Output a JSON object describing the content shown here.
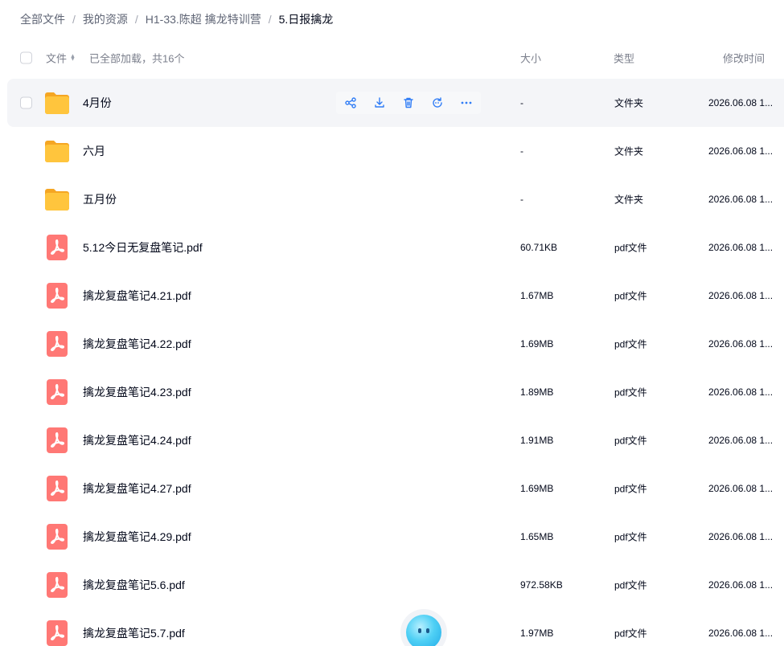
{
  "breadcrumb": {
    "items": [
      "全部文件",
      "我的资源",
      "H1-33.陈超 擒龙特训营"
    ],
    "current": "5.日报擒龙",
    "separator": "/"
  },
  "table": {
    "header": {
      "name": "文件",
      "count": "已全部加载，共16个",
      "size": "大小",
      "type": "类型",
      "time": "修改时间"
    },
    "rows": [
      {
        "name": "4月份",
        "size": "-",
        "type": "文件夹",
        "time": "2026.06.08 1...",
        "kind": "folder"
      },
      {
        "name": "六月",
        "size": "-",
        "type": "文件夹",
        "time": "2026.06.08 1...",
        "kind": "folder"
      },
      {
        "name": "五月份",
        "size": "-",
        "type": "文件夹",
        "time": "2026.06.08 1...",
        "kind": "folder"
      },
      {
        "name": "5.12今日无复盘笔记.pdf",
        "size": "60.71KB",
        "type": "pdf文件",
        "time": "2026.06.08 1...",
        "kind": "pdf"
      },
      {
        "name": "擒龙复盘笔记4.21.pdf",
        "size": "1.67MB",
        "type": "pdf文件",
        "time": "2026.06.08 1...",
        "kind": "pdf"
      },
      {
        "name": "擒龙复盘笔记4.22.pdf",
        "size": "1.69MB",
        "type": "pdf文件",
        "time": "2026.06.08 1...",
        "kind": "pdf"
      },
      {
        "name": "擒龙复盘笔记4.23.pdf",
        "size": "1.89MB",
        "type": "pdf文件",
        "time": "2026.06.08 1...",
        "kind": "pdf"
      },
      {
        "name": "擒龙复盘笔记4.24.pdf",
        "size": "1.91MB",
        "type": "pdf文件",
        "time": "2026.06.08 1...",
        "kind": "pdf"
      },
      {
        "name": "擒龙复盘笔记4.27.pdf",
        "size": "1.69MB",
        "type": "pdf文件",
        "time": "2026.06.08 1...",
        "kind": "pdf"
      },
      {
        "name": "擒龙复盘笔记4.29.pdf",
        "size": "1.65MB",
        "type": "pdf文件",
        "time": "2026.06.08 1...",
        "kind": "pdf"
      },
      {
        "name": "擒龙复盘笔记5.6.pdf",
        "size": "972.58KB",
        "type": "pdf文件",
        "time": "2026.06.08 1...",
        "kind": "pdf"
      },
      {
        "name": "擒龙复盘笔记5.7.pdf",
        "size": "1.97MB",
        "type": "pdf文件",
        "time": "2026.06.08 1...",
        "kind": "pdf"
      }
    ],
    "row_actions": [
      "share-icon",
      "download-icon",
      "delete-icon",
      "ai-chat-icon",
      "more-icon"
    ]
  },
  "colors": {
    "folder": "#ffc53d",
    "pdf": "#ff7875",
    "action": "#2f7cf6",
    "hover_row": "#f4f5f8"
  }
}
